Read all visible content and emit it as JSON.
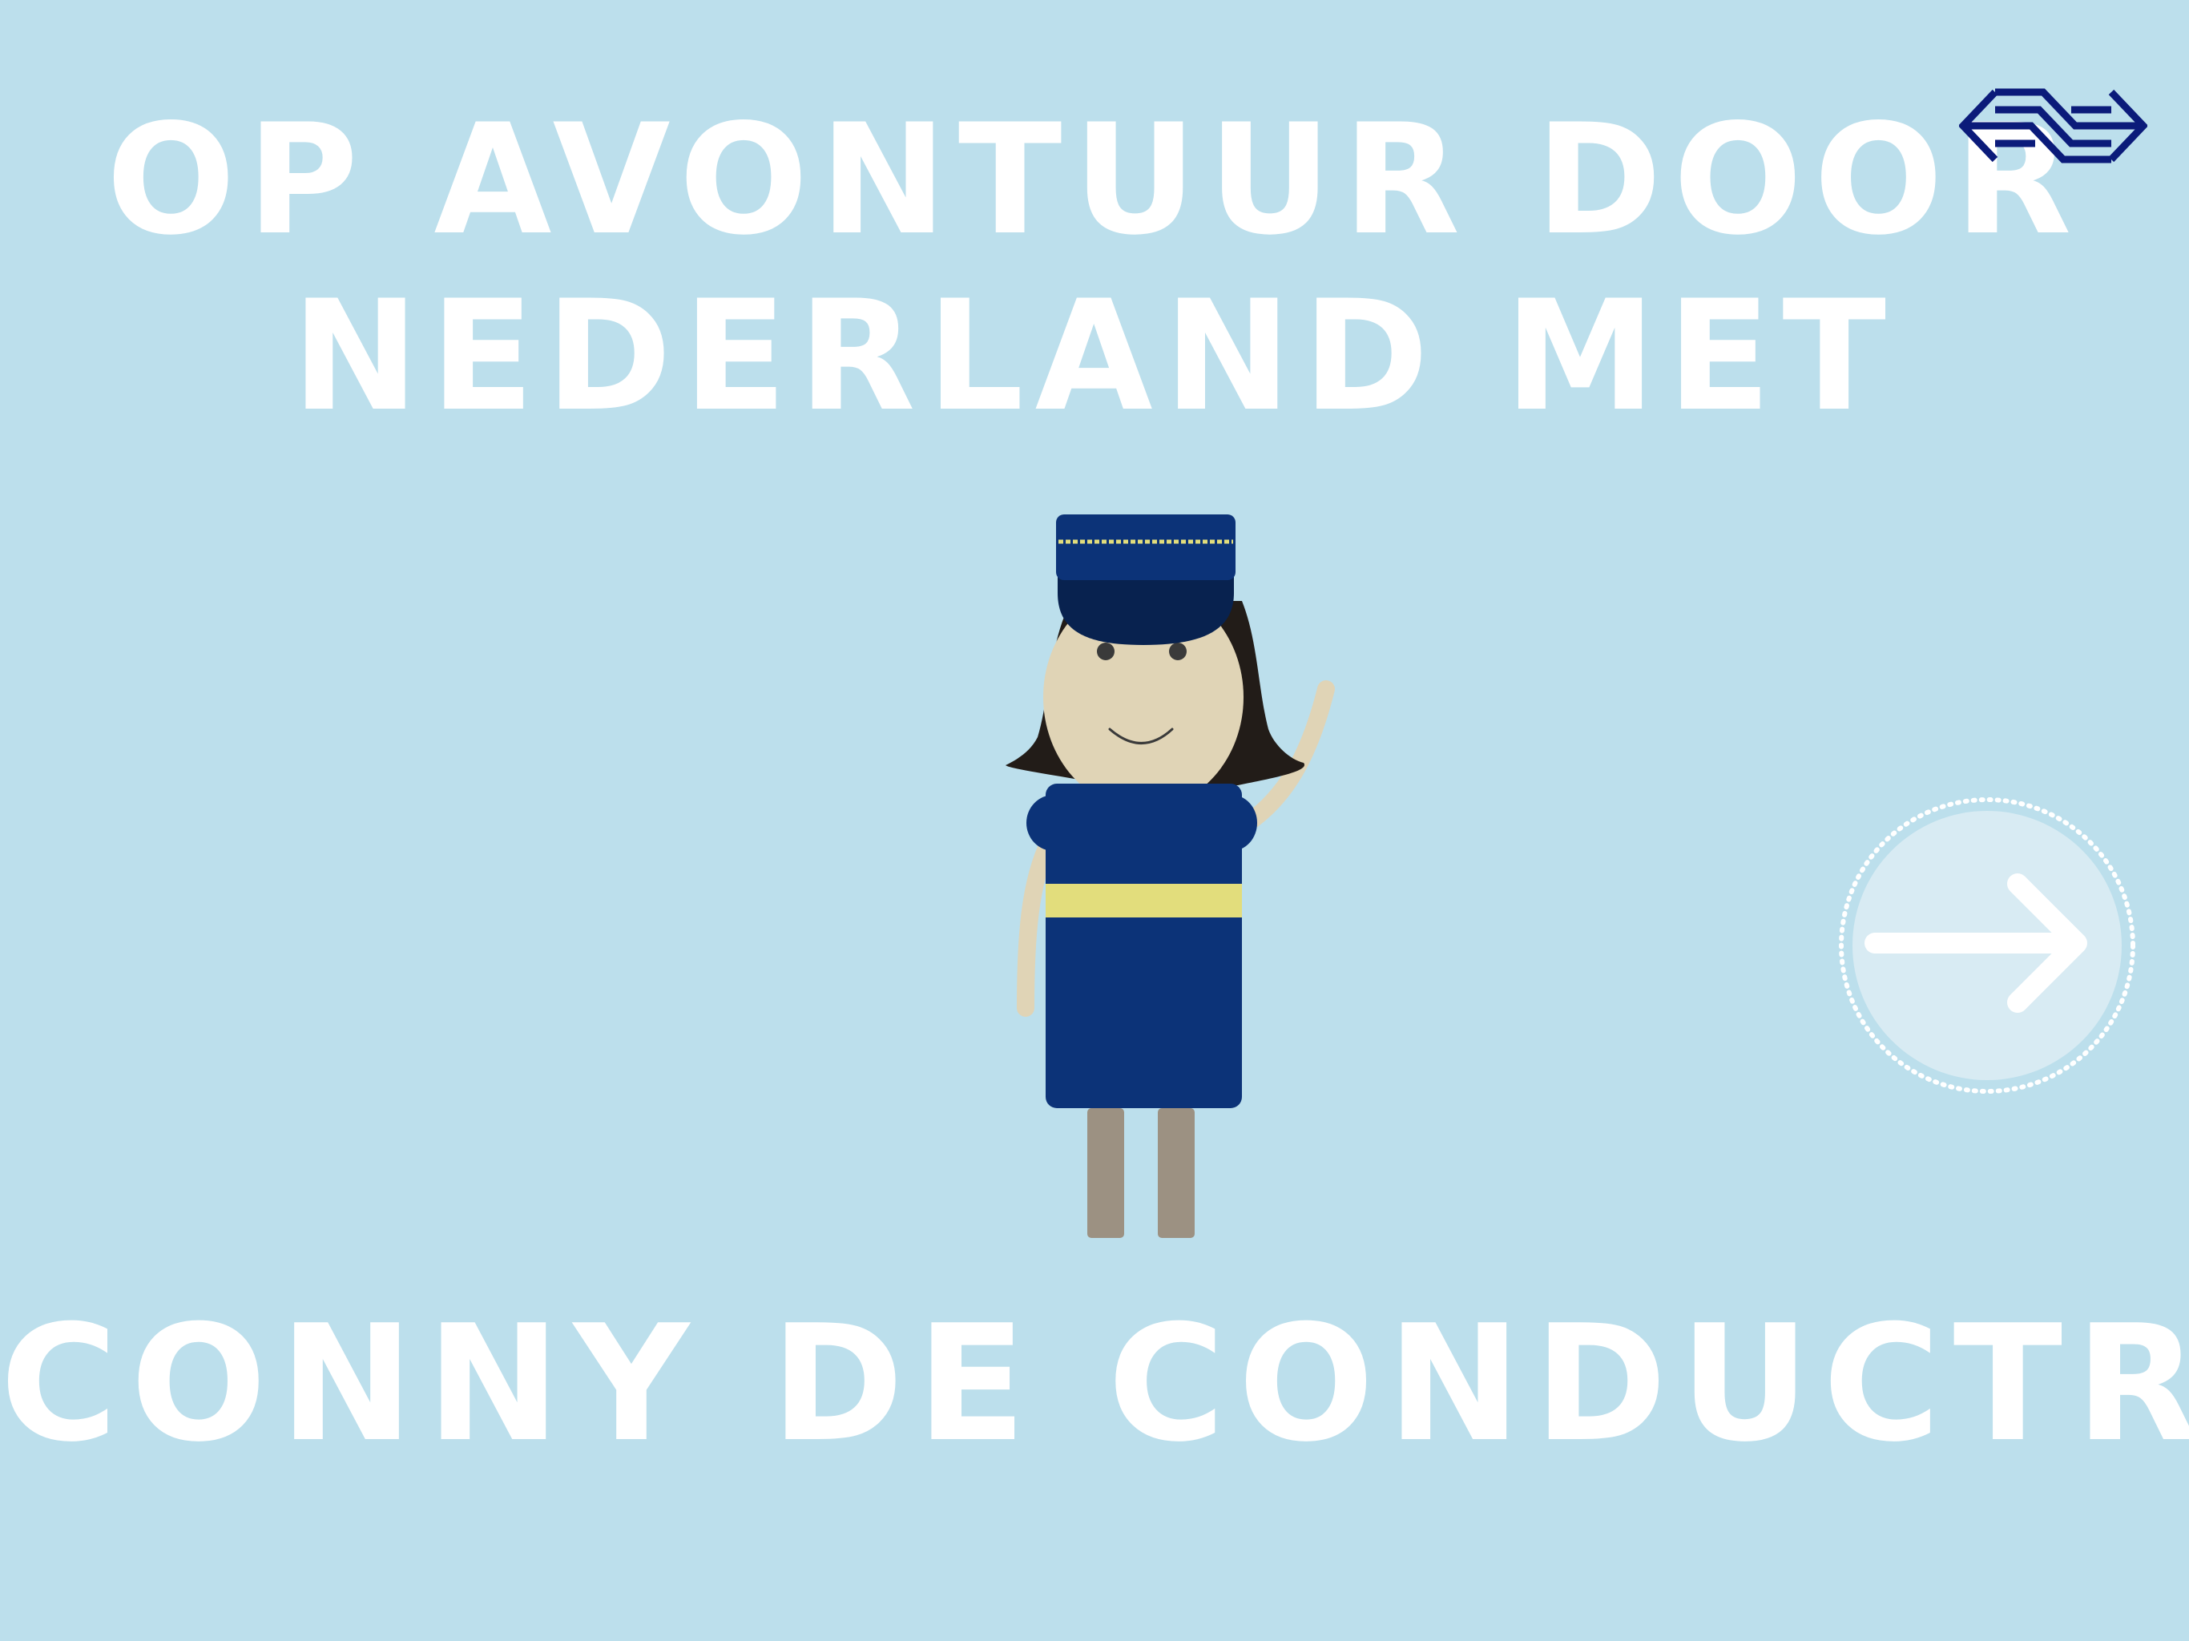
{
  "title": {
    "line1": "OP AVONTUUR DOOR",
    "line2": "NEDERLAND MET"
  },
  "subtitle": "CONNY DE CONDUCTRICE",
  "logo": {
    "icon": "ns-logo-icon",
    "color": "#0b1b7a"
  },
  "next_button": {
    "icon": "arrow-right-icon"
  },
  "colors": {
    "background": "#bcdfec",
    "text": "#ffffff",
    "uniform": "#0c3378",
    "uniform_stripe": "#e2dd7c",
    "skin": "#e0d4b6",
    "hair": "#221c18",
    "legs": "#9c9182"
  }
}
